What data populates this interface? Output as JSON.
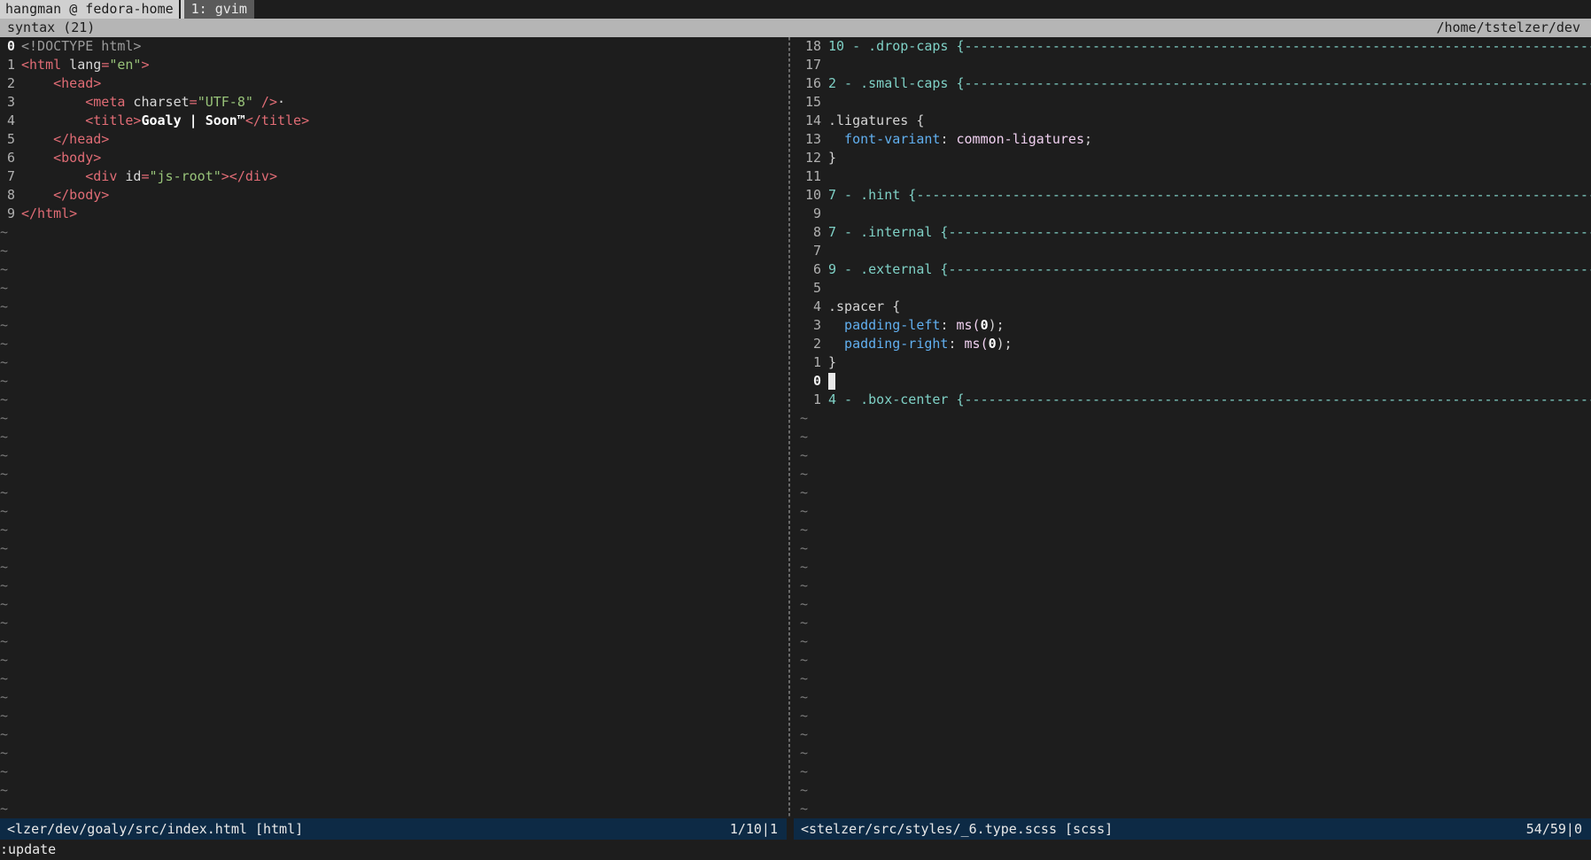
{
  "tmux": {
    "session": "hangman @ fedora-home",
    "window": "1: gvim"
  },
  "titlebar": {
    "left": "syntax (21)",
    "right": "/home/tstelzer/dev"
  },
  "left_pane": {
    "lines": [
      {
        "num": "0",
        "current": true
      },
      {
        "num": "1"
      },
      {
        "num": "2"
      },
      {
        "num": "3"
      },
      {
        "num": "4"
      },
      {
        "num": "5"
      },
      {
        "num": "6"
      },
      {
        "num": "7"
      },
      {
        "num": "8"
      },
      {
        "num": "9"
      }
    ],
    "code": {
      "l0": "<!DOCTYPE html>",
      "l1_open": "<html",
      "l1_attr": " lang",
      "l1_eq": "=",
      "l1_val": "\"en\"",
      "l1_close": ">",
      "l2": "    <head>",
      "l3_open": "        <meta",
      "l3_attr": " charset",
      "l3_eq": "=",
      "l3_val": "\"UTF-8\"",
      "l3_close": " />",
      "l3_trail": "·",
      "l4_open": "        <title>",
      "l4_text": "Goaly | Soon™",
      "l4_close": "</title>",
      "l5": "    </head>",
      "l6": "    <body>",
      "l7_open": "        <div",
      "l7_attr": " id",
      "l7_eq": "=",
      "l7_val": "\"js-root\"",
      "l7_close": "></div>",
      "l8": "    </body>",
      "l9": "</html>"
    },
    "tilde": "~"
  },
  "right_pane": {
    "lines": [
      {
        "num": "18",
        "text": "10 - .drop-caps {",
        "kind": "fold"
      },
      {
        "num": "17",
        "text": "",
        "kind": "blank"
      },
      {
        "num": "16",
        "text": "2 - .small-caps {",
        "kind": "fold"
      },
      {
        "num": "15",
        "text": "",
        "kind": "blank"
      },
      {
        "num": "14",
        "text": ".ligatures {",
        "kind": "plain"
      },
      {
        "num": "13",
        "prop": "  font-variant",
        "sep": ": ",
        "val": "common-ligatures",
        "end": ";",
        "kind": "decl"
      },
      {
        "num": "12",
        "text": "}",
        "kind": "plain"
      },
      {
        "num": "11",
        "text": "",
        "kind": "blank"
      },
      {
        "num": "10",
        "text": "7 - .hint {",
        "kind": "fold"
      },
      {
        "num": "9",
        "text": "",
        "kind": "blank"
      },
      {
        "num": "8",
        "text": "7 - .internal {",
        "kind": "fold"
      },
      {
        "num": "7",
        "text": "",
        "kind": "blank"
      },
      {
        "num": "6",
        "text": "9 - .external {",
        "kind": "fold"
      },
      {
        "num": "5",
        "text": "",
        "kind": "blank"
      },
      {
        "num": "4",
        "text": ".spacer {",
        "kind": "plain"
      },
      {
        "num": "3",
        "prop": "  padding-left",
        "sep": ": ",
        "val": "ms(",
        "arg": "0",
        "end": ");",
        "kind": "decl"
      },
      {
        "num": "2",
        "prop": "  padding-right",
        "sep": ": ",
        "val": "ms(",
        "arg": "0",
        "end": ");",
        "kind": "decl"
      },
      {
        "num": "1",
        "text": "}",
        "kind": "plain"
      },
      {
        "num": "0",
        "text": "",
        "kind": "cursor"
      },
      {
        "num": "1",
        "text": "4 - .box-center {",
        "kind": "fold"
      }
    ],
    "tilde": "~"
  },
  "status_left": {
    "file": "<lzer/dev/goaly/src/index.html [html]",
    "pos": "1/10|1"
  },
  "status_right": {
    "file": "<stelzer/src/styles/_6.type.scss [scss]",
    "pos": "54/59|0"
  },
  "cmdline": ":update"
}
